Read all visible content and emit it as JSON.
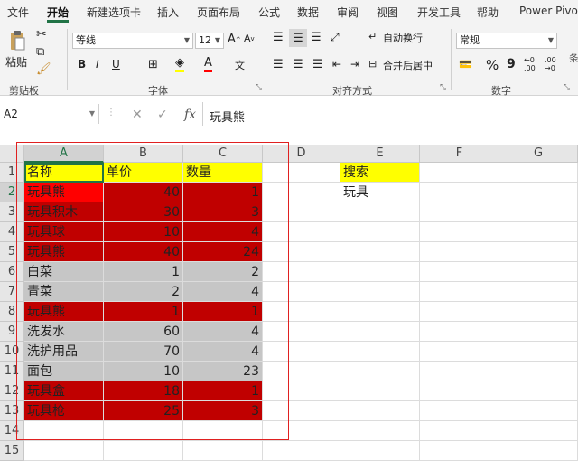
{
  "ribbon_tabs": [
    "文件",
    "开始",
    "新建选项卡",
    "插入",
    "页面布局",
    "公式",
    "数据",
    "审阅",
    "视图",
    "开发工具",
    "帮助",
    "Power Pivot"
  ],
  "active_tab": "开始",
  "clipboard": {
    "paste_label": "粘贴",
    "group_label": "剪贴板"
  },
  "font": {
    "name": "等线",
    "size": "12",
    "bold": "B",
    "italic": "I",
    "underline": "U",
    "wen": "文",
    "group_label": "字体"
  },
  "alignment": {
    "wrap_label": "自动换行",
    "merge_label": "合并后居中",
    "group_label": "对齐方式"
  },
  "number": {
    "format": "常规",
    "percent": "%",
    "comma": "9",
    "group_label": "数字"
  },
  "styles_partial": "条",
  "name_box": "A2",
  "formula_value": "玩具熊",
  "columns": [
    "A",
    "B",
    "C",
    "D",
    "E",
    "F",
    "G"
  ],
  "rows": [
    "1",
    "2",
    "3",
    "4",
    "5",
    "6",
    "7",
    "8",
    "9",
    "10",
    "11",
    "12",
    "13",
    "14",
    "15"
  ],
  "table": {
    "headers": [
      "名称",
      "单价",
      "数量"
    ],
    "rows": [
      [
        "玩具熊",
        "40",
        "1"
      ],
      [
        "玩具积木",
        "30",
        "3"
      ],
      [
        "玩具球",
        "10",
        "4"
      ],
      [
        "玩具熊",
        "40",
        "24"
      ],
      [
        "白菜",
        "1",
        "2"
      ],
      [
        "青菜",
        "2",
        "4"
      ],
      [
        "玩具熊",
        "1",
        "1"
      ],
      [
        "洗发水",
        "60",
        "4"
      ],
      [
        "洗护用品",
        "70",
        "4"
      ],
      [
        "面包",
        "10",
        "23"
      ],
      [
        "玩具盒",
        "18",
        "1"
      ],
      [
        "玩具枪",
        "25",
        "3"
      ]
    ],
    "highlighted_rows": [
      true,
      true,
      true,
      true,
      false,
      false,
      true,
      false,
      false,
      false,
      true,
      true
    ]
  },
  "search": {
    "label": "搜索",
    "value": "玩具"
  },
  "colors": {
    "header_yellow": "#ffff00",
    "match_red": "#c00000",
    "first_cell_red": "#ff0000",
    "normal_gray": "#c6c6c6",
    "excel_green": "#217346"
  }
}
